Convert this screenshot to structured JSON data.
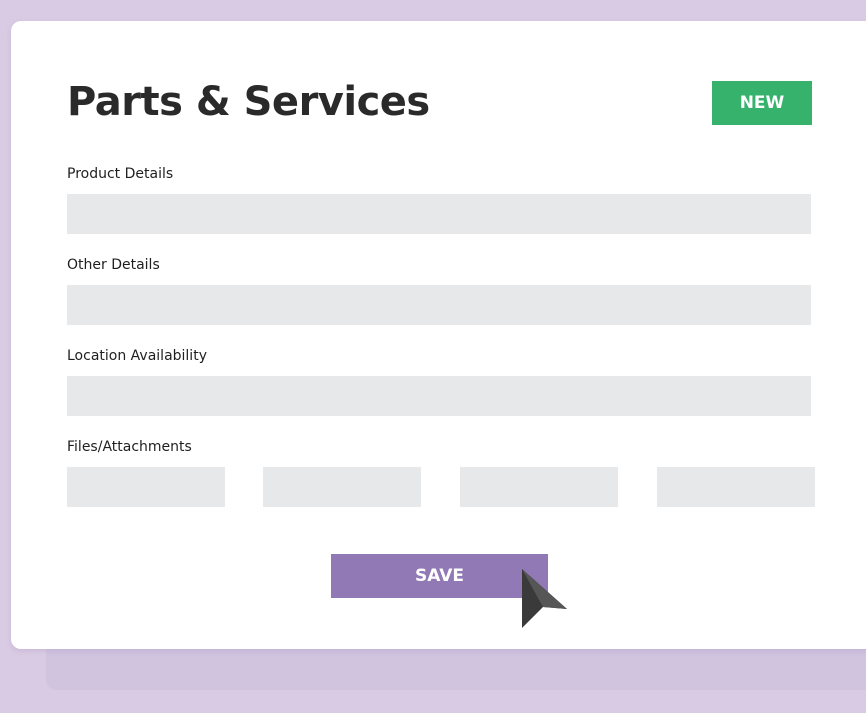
{
  "form": {
    "title": "Parts & Services",
    "new_label": "NEW",
    "fields": [
      {
        "label": "Product Details",
        "value": "",
        "placeholder": ""
      },
      {
        "label": "Other Details",
        "value": "",
        "placeholder": ""
      },
      {
        "label": "Location Availability",
        "value": "",
        "placeholder": ""
      }
    ],
    "attachments_label": "Files/Attachments",
    "save_label": "SAVE"
  },
  "icons": {
    "cursor": "mouse-pointer-icon"
  },
  "colors": {
    "background": "#d9cbe4",
    "card": "#ffffff",
    "new_button": "#37b26c",
    "save_button": "#9179b6",
    "input_fill": "#e7e8ea",
    "title_text": "#2a2a2a"
  }
}
